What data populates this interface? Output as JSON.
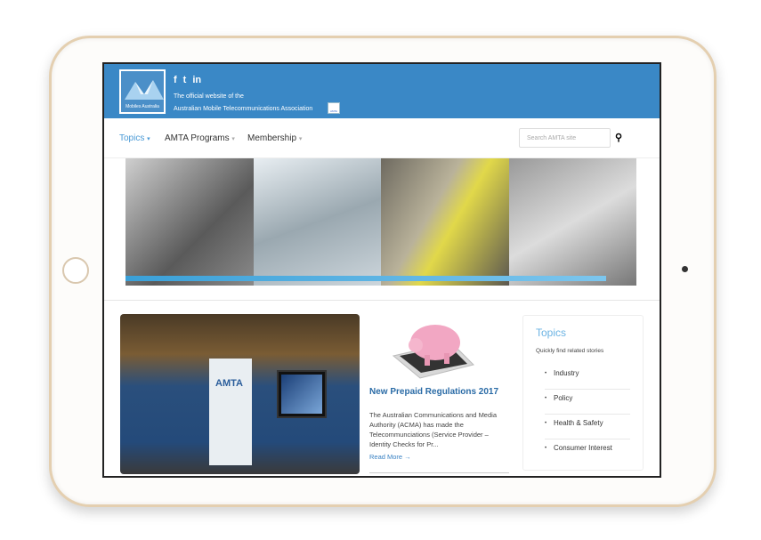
{
  "header": {
    "logo_text": "Mobiles Australia",
    "social": [
      "f",
      "t",
      "in"
    ],
    "tagline_1": "The official website of the",
    "tagline_2": "Australian Mobile Telecommunications Association",
    "amta_badge": "AMTA"
  },
  "nav": {
    "items": [
      {
        "label": "Topics",
        "active": true
      },
      {
        "label": "AMTA Programs"
      },
      {
        "label": "Membership"
      }
    ],
    "search_placeholder": "Search AMTA site"
  },
  "photo": {
    "banner_text": "AMTA"
  },
  "article": {
    "title": "New Prepaid Regulations 2017",
    "body": "The Australian Communications and Media Authority (ACMA) has made the Telecommunciations (Service Provider – Identity Checks for Pr...",
    "read_more": "Read More →"
  },
  "topics": {
    "title": "Topics",
    "subtitle": "Quickly find related stories",
    "items": [
      "Industry",
      "Policy",
      "Health & Safety",
      "Consumer Interest"
    ]
  },
  "colors": {
    "header": "#3a88c6",
    "accent": "#6bb3e3",
    "link": "#2a6ba6"
  }
}
